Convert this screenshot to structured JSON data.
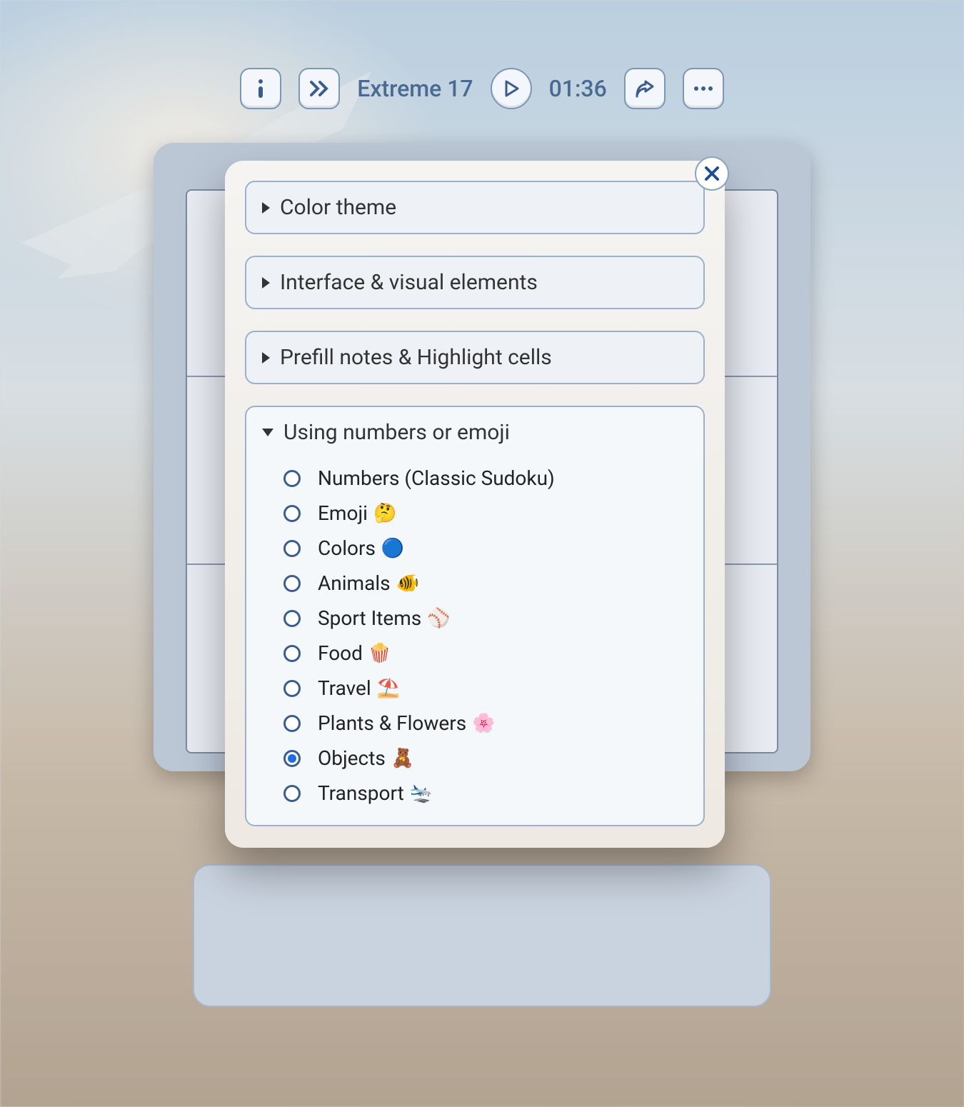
{
  "toolbar": {
    "difficulty_label": "Extreme 17",
    "timer": "01:36"
  },
  "modal": {
    "sections": [
      {
        "title": "Color theme"
      },
      {
        "title": "Interface & visual elements"
      },
      {
        "title": "Prefill notes & Highlight cells"
      },
      {
        "title": "Using numbers or emoji"
      }
    ],
    "emoji_options": [
      {
        "label": "Numbers (Classic Sudoku)",
        "emoji": "",
        "selected": false
      },
      {
        "label": "Emoji",
        "emoji": "🤔",
        "selected": false
      },
      {
        "label": "Colors",
        "emoji": "🔵",
        "selected": false
      },
      {
        "label": "Animals",
        "emoji": "🐠",
        "selected": false
      },
      {
        "label": "Sport Items",
        "emoji": "⚾",
        "selected": false
      },
      {
        "label": "Food",
        "emoji": "🍿",
        "selected": false
      },
      {
        "label": "Travel",
        "emoji": "⛱️",
        "selected": false
      },
      {
        "label": "Plants & Flowers",
        "emoji": "🌸",
        "selected": false
      },
      {
        "label": "Objects",
        "emoji": "🧸",
        "selected": true
      },
      {
        "label": "Transport",
        "emoji": "🛬",
        "selected": false
      }
    ]
  }
}
